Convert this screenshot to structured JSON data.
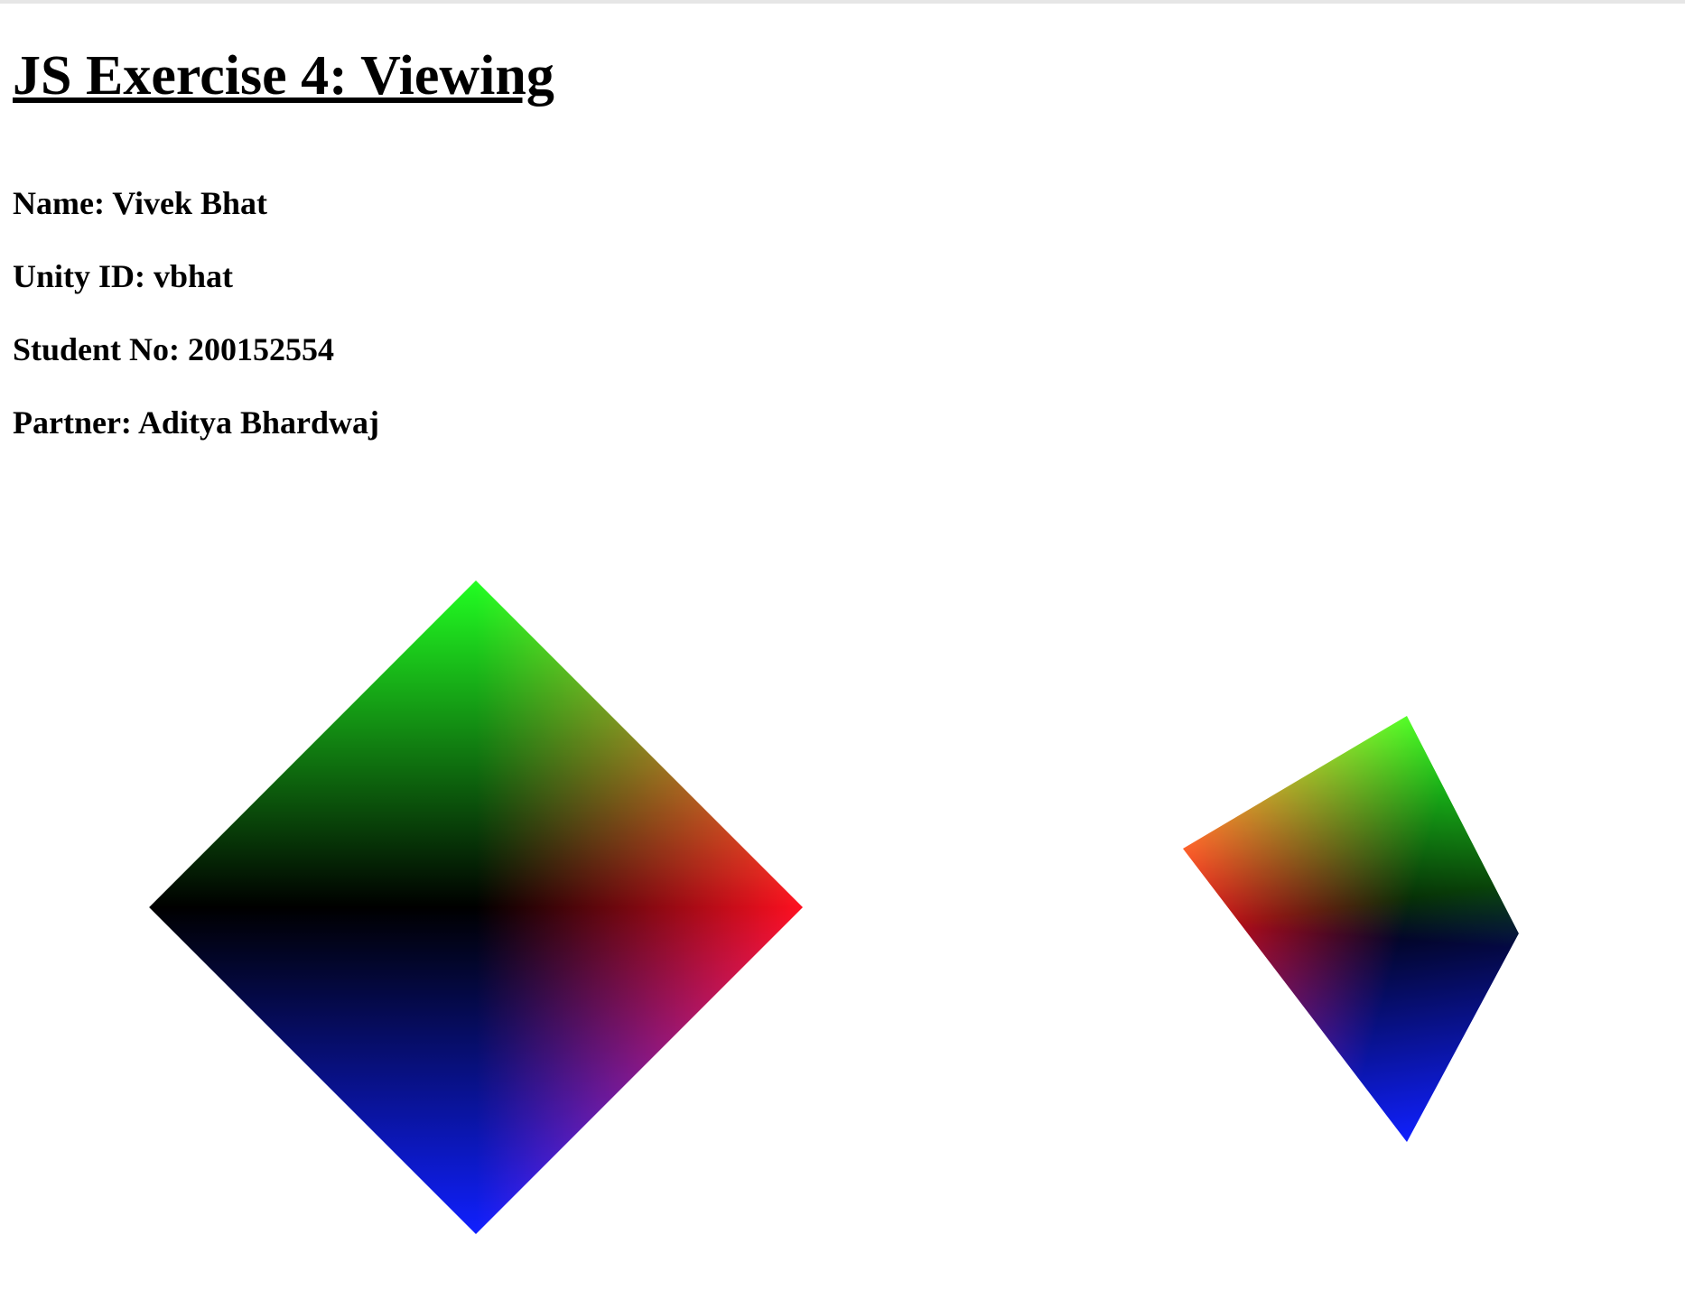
{
  "page": {
    "title": "JS Exercise 4: Viewing",
    "name_line": "Name: Vivek Bhat",
    "unity_line": "Unity ID: vbhat",
    "student_line": "Student No: 200152554",
    "partner_line": "Partner: Aditya Bhardwaj"
  },
  "scene": {
    "left_shape": "orthographic-square",
    "right_shape": "perspective-square",
    "vertex_colors": [
      "#22ff22",
      "#ff1020",
      "#1020ff",
      "#000000"
    ]
  }
}
